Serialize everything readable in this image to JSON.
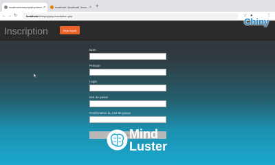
{
  "browser": {
    "tabs": [
      {
        "title": "localhost/cinephp/php/inscr..."
      },
      {
        "title": "localhost / localhost / loca..."
      }
    ],
    "new_tab": "+",
    "url_host": "localhost",
    "url_path": "/cinephp/php/inscription.php",
    "window_controls": [
      "–",
      "□",
      "×"
    ]
  },
  "header": {
    "title": "Inscription",
    "already_registered_button": "Déjà inscrit"
  },
  "form": {
    "fields": [
      {
        "label": "Nom",
        "value": ""
      },
      {
        "label": "Prénom",
        "value": ""
      },
      {
        "label": "Login",
        "value": ""
      },
      {
        "label": "Mot de passe",
        "value": ""
      },
      {
        "label": "Confirmation du mot de passe",
        "value": ""
      }
    ],
    "submit_label": "S'inscrire"
  },
  "watermarks": {
    "top_right": "Chiny",
    "bottom_line1": "Mind",
    "bottom_line2": "Luster"
  },
  "colors": {
    "accent_orange": "#e8622a",
    "gradient_bottom": "#1ba8cf",
    "header_bg": "#2b2b2b"
  }
}
